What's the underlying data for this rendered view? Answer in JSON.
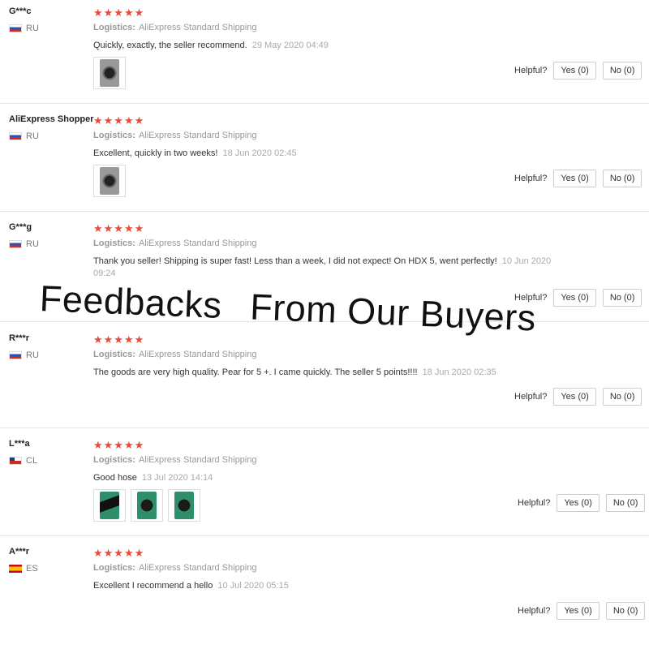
{
  "helpful_label": "Helpful?",
  "overlay": {
    "part1": "Feedbacks",
    "part2": "From Our Buyers"
  },
  "stars_text": "★★★★★",
  "rating_color": "#e94a3a",
  "logistics_label": "Logistics:",
  "reviews": [
    {
      "user": "G***c",
      "country": "RU",
      "flag": "russia-flag-icon",
      "stars": 5,
      "shipping": "AliExpress Standard Shipping",
      "comment": "Quickly, exactly, the seller recommend.",
      "date": "29 May 2020 04:49",
      "photos": 1,
      "yes": "Yes (0)",
      "no": "No (0)"
    },
    {
      "user": "AliExpress Shopper",
      "country": "RU",
      "flag": "russia-flag-icon",
      "stars": 5,
      "shipping": "AliExpress Standard Shipping",
      "comment": "Excellent, quickly in two weeks!",
      "date": "18 Jun 2020 02:45",
      "photos": 1,
      "yes": "Yes (0)",
      "no": "No (0)"
    },
    {
      "user": "G***g",
      "country": "RU",
      "flag": "russia-flag-icon",
      "stars": 5,
      "shipping": "AliExpress Standard Shipping",
      "comment": "Thank you seller! Shipping is super fast! Less than a week, I did not expect! On HDX 5, went perfectly!",
      "date": "10 Jun 2020 09:24",
      "photos": 0,
      "yes": "Yes (0)",
      "no": "No (0)"
    },
    {
      "user": "R***r",
      "country": "RU",
      "flag": "russia-flag-icon",
      "stars": 5,
      "shipping": "AliExpress Standard Shipping",
      "comment": "The goods are very high quality. Pear for 5 +. I came quickly. The seller 5 points!!!!",
      "date": "18 Jun 2020 02:35",
      "photos": 0,
      "yes": "Yes (0)",
      "no": "No (0)"
    },
    {
      "user": "L***a",
      "country": "CL",
      "flag": "chile-flag-icon",
      "stars": 5,
      "shipping": "AliExpress Standard Shipping",
      "comment": "Good hose",
      "date": "13 Jul 2020 14:14",
      "photos": 3,
      "yes": "Yes (0)",
      "no": "No (0)"
    },
    {
      "user": "A***r",
      "country": "ES",
      "flag": "spain-flag-icon",
      "stars": 5,
      "shipping": "AliExpress Standard Shipping",
      "comment": "Excellent I recommend a hello",
      "date": "10 Jul 2020 05:15",
      "photos": 0,
      "yes": "Yes (0)",
      "no": "No (0)"
    }
  ]
}
